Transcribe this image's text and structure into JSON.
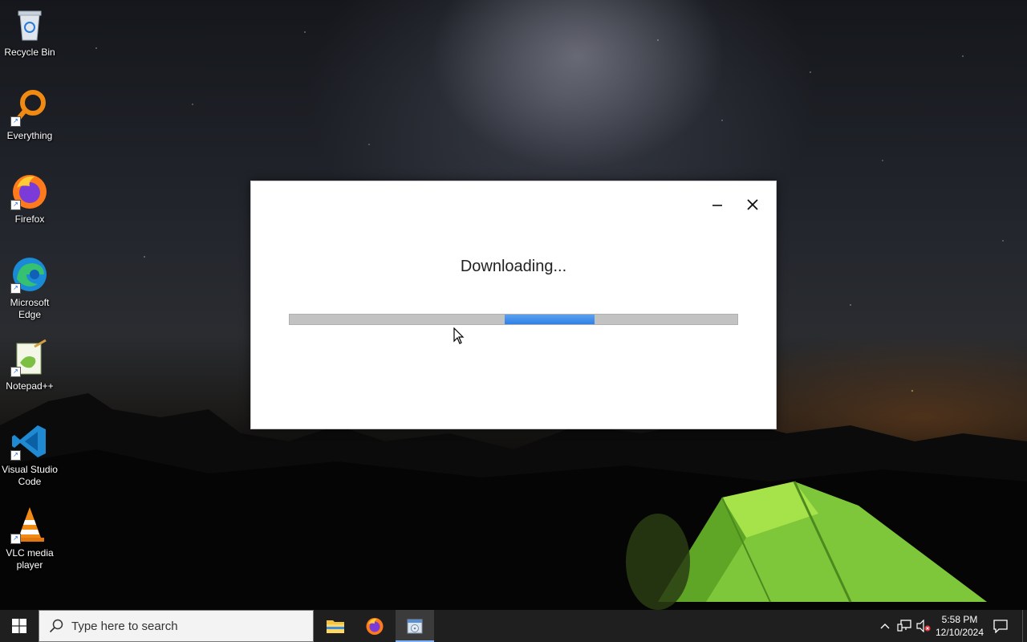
{
  "desktop": {
    "icons": [
      {
        "label": "Recycle Bin",
        "icon": "recycle-bin-icon"
      },
      {
        "label": "Everything",
        "icon": "everything-search-icon"
      },
      {
        "label": "Firefox",
        "icon": "firefox-icon"
      },
      {
        "label": "Microsoft Edge",
        "icon": "edge-icon"
      },
      {
        "label": "Notepad++",
        "icon": "notepadplusplus-icon"
      },
      {
        "label": "Visual Studio Code",
        "icon": "vscode-icon"
      },
      {
        "label": "VLC media player",
        "icon": "vlc-icon"
      }
    ]
  },
  "dialog": {
    "status": "Downloading...",
    "progress_state": "indeterminate",
    "accent_color": "#3a8ae8"
  },
  "taskbar": {
    "search_placeholder": "Type here to search",
    "apps": [
      {
        "name": "File Explorer",
        "icon": "folder-icon"
      },
      {
        "name": "Firefox",
        "icon": "firefox-icon"
      },
      {
        "name": "Installer",
        "icon": "installer-icon",
        "active": true
      }
    ],
    "clock": {
      "time": "5:58 PM",
      "date": "12/10/2024"
    }
  }
}
